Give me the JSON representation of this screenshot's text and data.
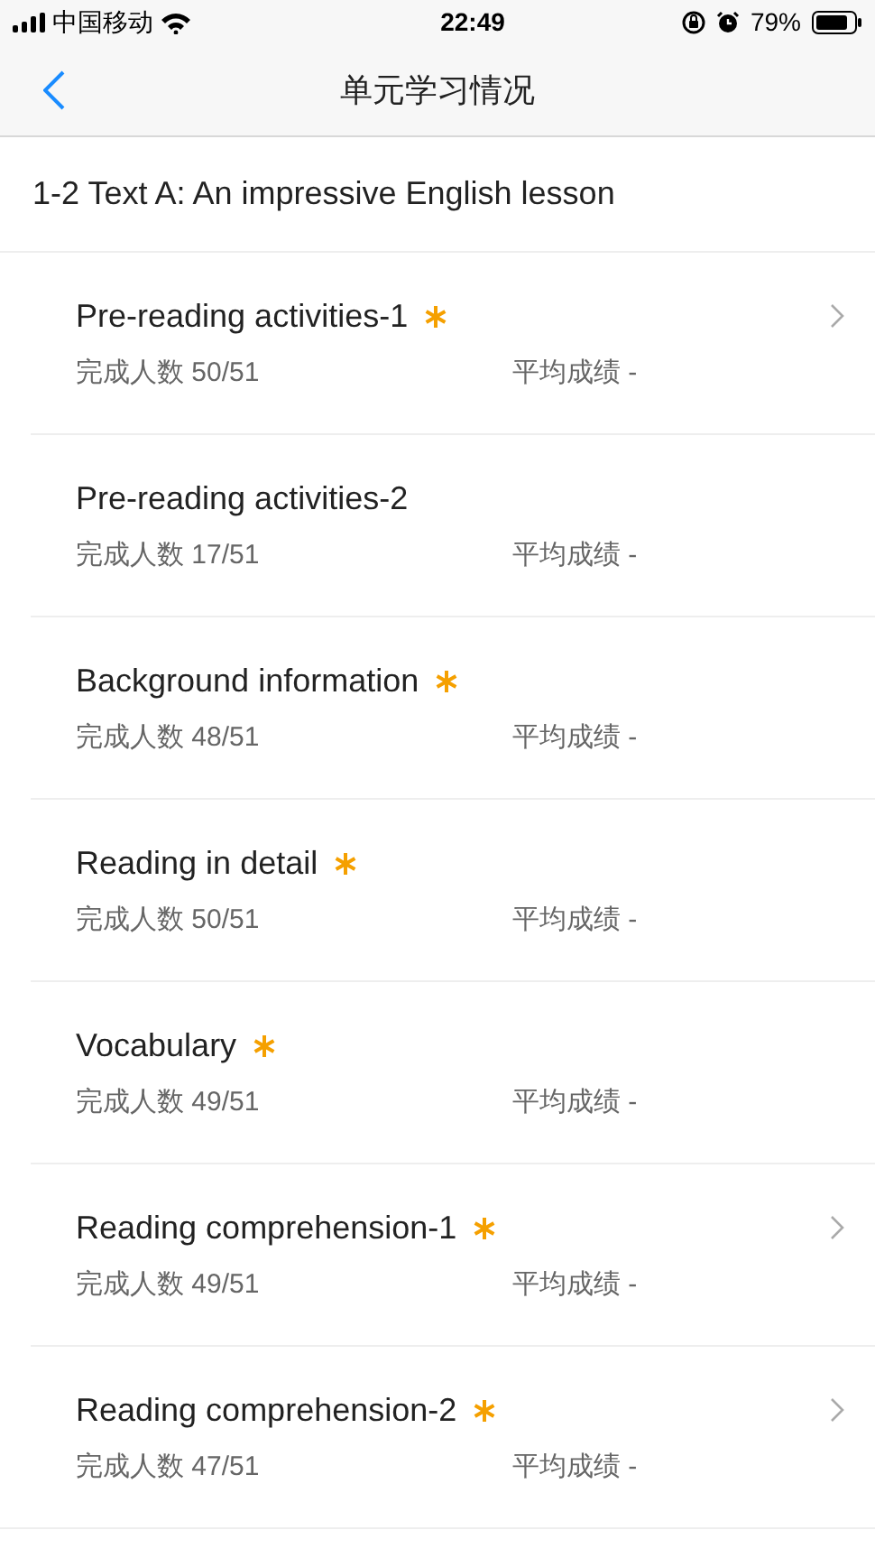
{
  "status_bar": {
    "carrier": "中国移动",
    "time": "22:49",
    "battery_percent": "79%"
  },
  "nav": {
    "title": "单元学习情况"
  },
  "lesson_title": "1-2 Text A: An impressive English lesson",
  "activities": [
    {
      "title": "Pre-reading activities-1",
      "starred": true,
      "has_detail": true,
      "completed_label": "完成人数 50/51",
      "average_label": "平均成绩 -"
    },
    {
      "title": "Pre-reading activities-2",
      "starred": false,
      "has_detail": false,
      "completed_label": "完成人数 17/51",
      "average_label": "平均成绩 -"
    },
    {
      "title": "Background information",
      "starred": true,
      "has_detail": false,
      "completed_label": "完成人数 48/51",
      "average_label": "平均成绩 -"
    },
    {
      "title": "Reading in detail",
      "starred": true,
      "has_detail": false,
      "completed_label": "完成人数 50/51",
      "average_label": "平均成绩 -"
    },
    {
      "title": "Vocabulary",
      "starred": true,
      "has_detail": false,
      "completed_label": "完成人数 49/51",
      "average_label": "平均成绩 -"
    },
    {
      "title": "Reading comprehension-1",
      "starred": true,
      "has_detail": true,
      "completed_label": "完成人数 49/51",
      "average_label": "平均成绩 -"
    },
    {
      "title": "Reading comprehension-2",
      "starred": true,
      "has_detail": true,
      "completed_label": "完成人数 47/51",
      "average_label": "平均成绩 -"
    }
  ]
}
